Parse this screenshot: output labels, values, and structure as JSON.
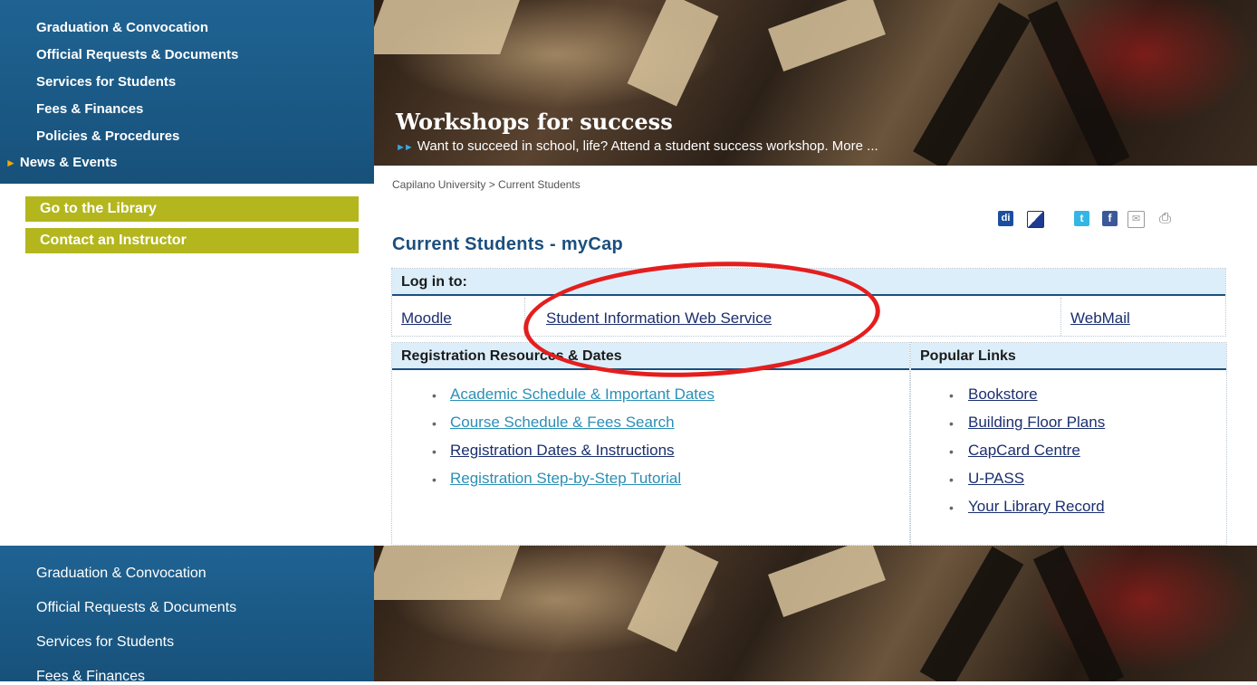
{
  "sidebar_top": {
    "items": [
      {
        "label": "Graduation & Convocation"
      },
      {
        "label": "Official Requests & Documents"
      },
      {
        "label": "Services for Students"
      },
      {
        "label": "Fees & Finances"
      },
      {
        "label": "Policies & Procedures"
      },
      {
        "label": "News & Events",
        "active_marker": "►"
      }
    ],
    "buttons": [
      {
        "label": "Go to the Library"
      },
      {
        "label": "Contact an Instructor"
      }
    ]
  },
  "banner": {
    "title": "Workshops for success",
    "subtitle": "Want to succeed in school, life? Attend a student success workshop. More ...",
    "subtitle_marker": "►►"
  },
  "breadcrumb": "Capilano University > Current Students",
  "share_icons": [
    "digg-icon",
    "delicious-icon",
    "twitter-icon",
    "facebook-icon",
    "email-icon",
    "print-icon"
  ],
  "page_title": "Current Students - myCap",
  "login": {
    "heading": "Log in to:",
    "links": [
      {
        "label": "Moodle"
      },
      {
        "label": "Student Information Web Service"
      },
      {
        "label": "WebMail"
      }
    ]
  },
  "registration": {
    "heading": "Registration Resources & Dates",
    "links": [
      {
        "label": "Academic Schedule & Important Dates"
      },
      {
        "label": "Course Schedule & Fees Search"
      },
      {
        "label": "Registration Dates & Instructions"
      },
      {
        "label": "Registration Step-by-Step Tutorial"
      }
    ]
  },
  "popular": {
    "heading": "Popular Links",
    "links": [
      {
        "label": "Bookstore"
      },
      {
        "label": "Building Floor Plans"
      },
      {
        "label": "CapCard Centre"
      },
      {
        "label": "U-PASS"
      },
      {
        "label": "Your Library Record"
      }
    ]
  },
  "sidebar_bottom": {
    "items": [
      {
        "label": "Graduation & Convocation"
      },
      {
        "label": "Official Requests & Documents"
      },
      {
        "label": "Services for Students"
      },
      {
        "label": "Fees & Finances"
      }
    ]
  },
  "colors": {
    "nav_blue": "#1d5d8c",
    "button_olive": "#b4b61e",
    "heading_blue": "#1b4f7e",
    "annotation_red": "#e41e1e"
  }
}
